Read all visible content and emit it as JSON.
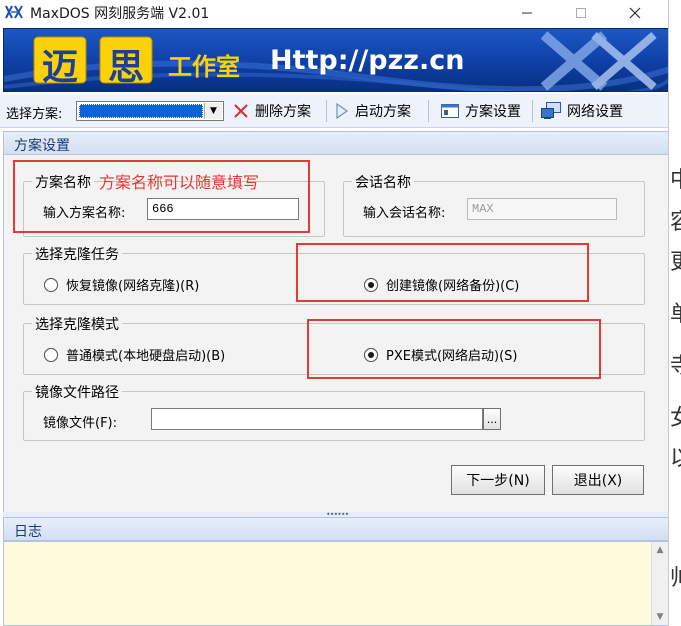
{
  "window": {
    "title": "MaxDOS 网刻服务端 V2.01"
  },
  "banner": {
    "logo_chars": [
      "迈",
      "思"
    ],
    "studio": "工作室",
    "url": "Http://pzz.cn"
  },
  "toolbar": {
    "scheme_label": "选择方案:",
    "scheme_value": "",
    "delete_label": "删除方案",
    "start_label": "启动方案",
    "scheme_settings_label": "方案设置",
    "network_settings_label": "网络设置"
  },
  "section": {
    "title": "方案设置"
  },
  "scheme_name": {
    "legend": "方案名称",
    "label": "输入方案名称:",
    "value": "666"
  },
  "session_name": {
    "legend": "会话名称",
    "label": "输入会话名称:",
    "value": "MAX"
  },
  "clone_task": {
    "legend": "选择克隆任务",
    "option_restore": "恢复镜像(网络克隆)(R)",
    "option_create": "创建镜像(网络备份)(C)",
    "selected": "create"
  },
  "clone_mode": {
    "legend": "选择克隆模式",
    "option_normal": "普通模式(本地硬盘启动)(B)",
    "option_pxe": "PXE模式(网络启动)(S)",
    "selected": "pxe"
  },
  "image_path": {
    "legend": "镜像文件路径",
    "label": "镜像文件(F):",
    "value": "",
    "browse_label": "..."
  },
  "buttons": {
    "next": "下一步(N)",
    "exit": "退出(X)"
  },
  "annotation": {
    "note": "方案名称可以随意填写",
    "color": "#e53935"
  },
  "log": {
    "title": "日志"
  },
  "background": {
    "chars": [
      "中",
      "容",
      "更",
      "单",
      "寺",
      "女",
      "以",
      "帅"
    ]
  }
}
